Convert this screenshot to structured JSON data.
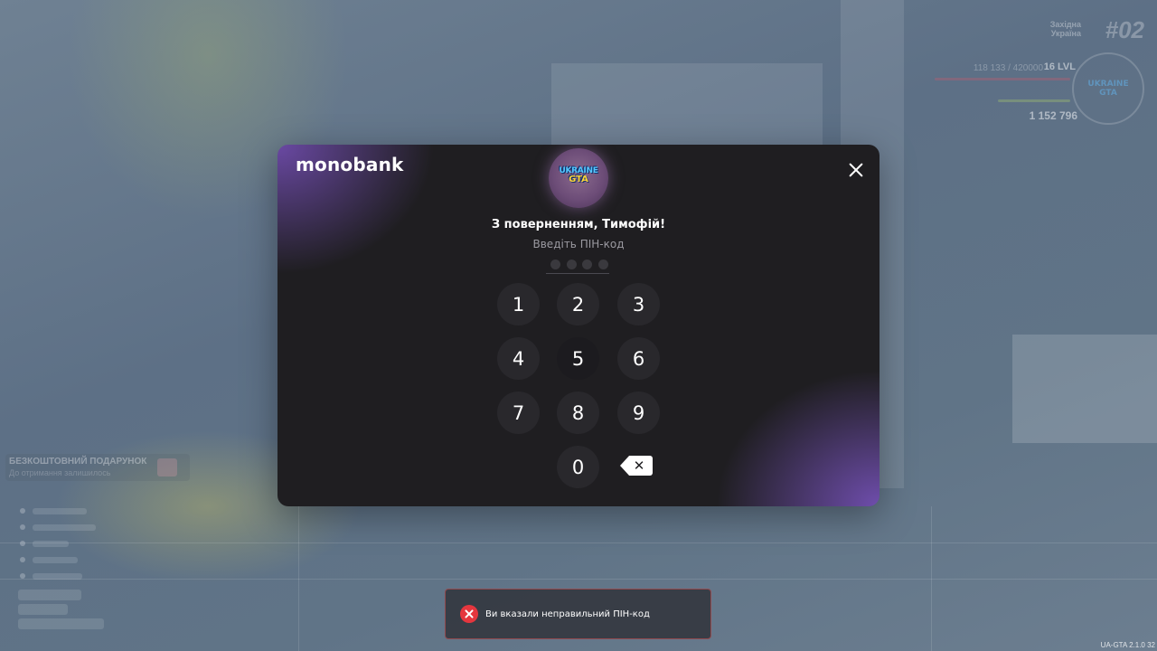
{
  "hud": {
    "region_line1": "Західна",
    "region_line2": "Україна",
    "server_number": "#02",
    "xp_text": "118 133 / 420000",
    "level_text": "16 LVL",
    "money_text": "1 152 796",
    "logo_text": "UKRAINE GTA"
  },
  "left_hud": {
    "gift_title": "БЕЗКОШТОВНИЙ ПОДАРУНОК",
    "gift_subtitle": "До отримання залишилось"
  },
  "version": "UA-GTA 2.1.0 32",
  "modal": {
    "brand": "monobank",
    "avatar_line1": "UKRAINE",
    "avatar_line2": "GTA",
    "welcome": "З поверненням, Тимофій!",
    "hint": "Введіть ПІН-код",
    "pin_length": 4,
    "keys": [
      "1",
      "2",
      "3",
      "4",
      "5",
      "6",
      "7",
      "8",
      "9",
      "0"
    ],
    "backspace_icon": "backspace-icon",
    "close_icon": "close-icon"
  },
  "toast": {
    "icon": "error-icon",
    "message": "Ви вказали неправильний ПІН-код",
    "accent": "#e5363e"
  },
  "colors": {
    "modal_bg": "#1f1e21",
    "accent_purple": "#6e4baa",
    "key_bg": "#29282c"
  }
}
